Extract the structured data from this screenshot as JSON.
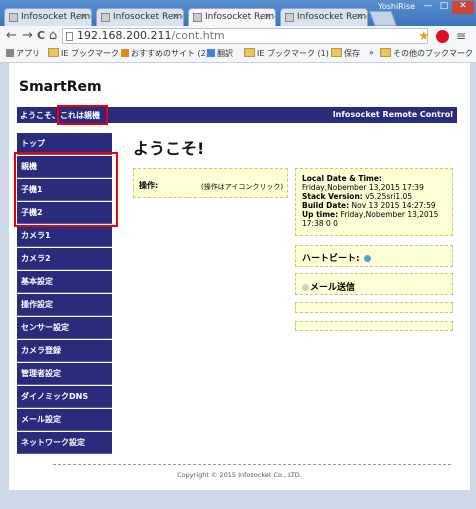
{
  "browser": {
    "tabs": [
      {
        "title": "Infosocket Remo"
      },
      {
        "title": "Infosocket Remo"
      },
      {
        "title": "Infosocket Remo"
      },
      {
        "title": "Infosocket Remo"
      }
    ],
    "tab_close": "×",
    "user": "YoshiRise",
    "window_buttons": {
      "minimize": "—",
      "maximize": "□",
      "close": "✕"
    },
    "back": "←",
    "forward": "→",
    "reload": "C",
    "home": "⌂",
    "url_host": "192.168.200.211",
    "url_path": "/cont.htm",
    "bookmarks": [
      {
        "label": "アプリ"
      },
      {
        "label": "IE ブックマーク"
      },
      {
        "label": "おすすめのサイト (2)"
      },
      {
        "label": "翻訳"
      },
      {
        "label": "IE ブックマーク (1)"
      },
      {
        "label": "保存"
      },
      {
        "label": "»"
      },
      {
        "label": "その他のブックマーク"
      }
    ]
  },
  "page": {
    "logo": "SmartRem",
    "welcome": "ようこそ、これは親機",
    "brand": "Infosocket Remote Control",
    "heading": "ようこそ!",
    "sidebar": [
      {
        "label": "トップ"
      },
      {
        "label": "親機"
      },
      {
        "label": "子機1"
      },
      {
        "label": "子機2"
      },
      {
        "label": "カメラ1"
      },
      {
        "label": "カメラ2"
      },
      {
        "label": "基本設定"
      },
      {
        "label": "操作設定"
      },
      {
        "label": "センサー設定"
      },
      {
        "label": "カメラ登録"
      },
      {
        "label": "管理者設定"
      },
      {
        "label": "ダイノミックDNS"
      },
      {
        "label": "メール設定"
      },
      {
        "label": "ネットワーク設定"
      }
    ],
    "operation": {
      "title": "操作:",
      "note": "(操作はアイコンクリック)"
    },
    "info": {
      "local_label": "Local Date & Time:",
      "local_value": "Friday,Nobember 13,2015 17:39",
      "stack_label": "Stack Version:",
      "stack_value": " v5.25sri1.05",
      "build_label": "Build Date:",
      "build_value": " Nov 13 2015 14:27:59",
      "uptime_label": "Up time:",
      "uptime_value": " Friday,Nobember 13,2015 17:38 0 0"
    },
    "heartbeat": {
      "label": "ハートビート:",
      "dot_color": "#5a9ad6"
    },
    "mail": {
      "label": "メール送信",
      "dot_color": "#cccccc"
    },
    "copyright": "Copyright © 2015 Infosocket Co., LTD."
  }
}
